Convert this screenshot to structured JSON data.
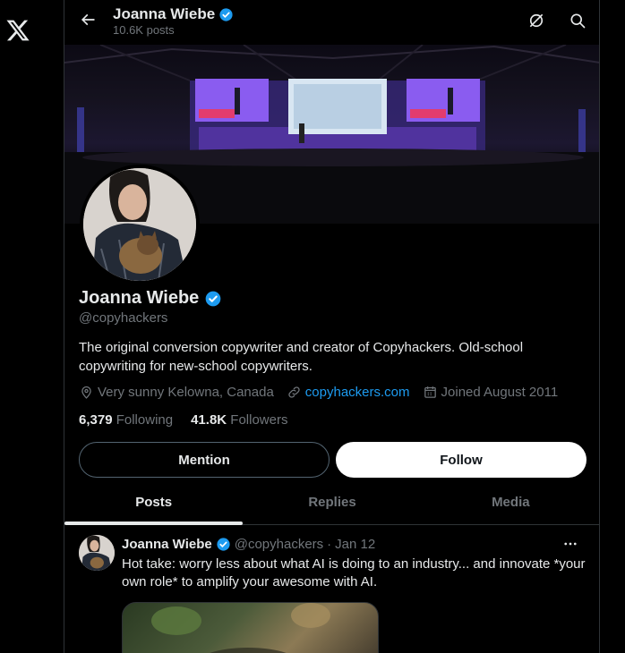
{
  "header": {
    "name": "Joanna Wiebe",
    "posts_count": "10.6K posts"
  },
  "profile": {
    "name": "Joanna Wiebe",
    "handle": "@copyhackers",
    "bio": "The original conversion copywriter and creator of Copyhackers. Old-school copywriting for new-school copywriters.",
    "location": "Very sunny Kelowna, Canada",
    "website": "copyhackers.com",
    "joined": "Joined August 2011",
    "following_count": "6,379",
    "following_label": "Following",
    "followers_count": "41.8K",
    "followers_label": "Followers",
    "mention_label": "Mention",
    "follow_label": "Follow"
  },
  "tabs": [
    {
      "label": "Posts",
      "active": true
    },
    {
      "label": "Replies",
      "active": false
    },
    {
      "label": "Media",
      "active": false
    }
  ],
  "tweet": {
    "name": "Joanna Wiebe",
    "handle": "@copyhackers",
    "separator": "·",
    "date": "Jan 12",
    "text": "Hot take: worry less about what AI is doing to an industry... and innovate *your own role* to amplify your awesome with AI."
  },
  "colors": {
    "background": "#000000",
    "text_primary": "#e7e9ea",
    "text_secondary": "#71767b",
    "accent_blue": "#1d9bf0",
    "border": "#2f3336"
  },
  "icons": [
    "x-logo-icon",
    "back-arrow-icon",
    "grok-icon",
    "search-icon",
    "verified-badge-icon",
    "location-pin-icon",
    "link-icon",
    "calendar-icon",
    "more-icon"
  ]
}
